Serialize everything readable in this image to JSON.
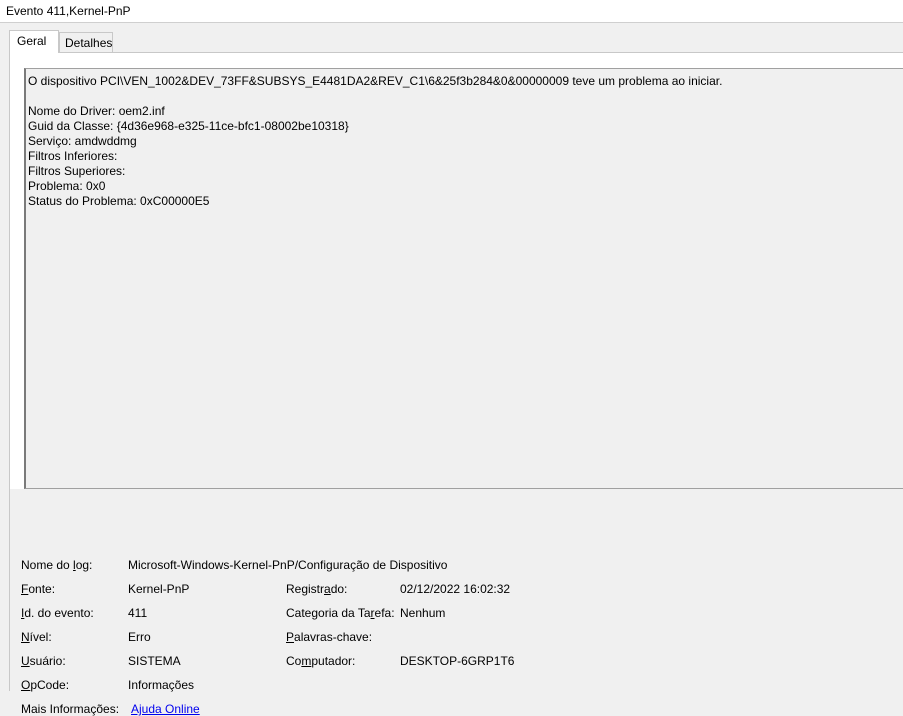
{
  "window": {
    "title": "Evento 411,Kernel-PnP"
  },
  "tabs": [
    {
      "label": "Geral",
      "active": true
    },
    {
      "label": "Detalhes",
      "active": false
    }
  ],
  "description": {
    "lines": [
      "O dispositivo PCI\\VEN_1002&DEV_73FF&SUBSYS_E4481DA2&REV_C1\\6&25f3b284&0&00000009 teve um problema ao iniciar.",
      "",
      "Nome do Driver: oem2.inf",
      "Guid da Classe: {4d36e968-e325-11ce-bfc1-08002be10318}",
      "Serviço: amdwddmg",
      "Filtros Inferiores:",
      "Filtros Superiores:",
      "Problema: 0x0",
      "Status do Problema: 0xC00000E5"
    ]
  },
  "properties": {
    "log_name": {
      "label_pre": "Nome do ",
      "label_u": "l",
      "label_post": "og:",
      "value": "Microsoft-Windows-Kernel-PnP/Configuração de Dispositivo"
    },
    "source": {
      "label_pre": "",
      "label_u": "F",
      "label_post": "onte:",
      "value": "Kernel-PnP"
    },
    "logged": {
      "label_pre": "Registr",
      "label_u": "a",
      "label_post": "do:",
      "value": "02/12/2022 16:02:32"
    },
    "event_id": {
      "label_pre": "",
      "label_u": "I",
      "label_post": "d. do evento:",
      "value": "411"
    },
    "task_category": {
      "label_pre": "Categoria da Ta",
      "label_u": "r",
      "label_post": "efa:",
      "value": "Nenhum"
    },
    "level": {
      "label_pre": "",
      "label_u": "N",
      "label_post": "ível:",
      "value": "Erro"
    },
    "keywords": {
      "label_pre": "",
      "label_u": "P",
      "label_post": "alavras-chave:",
      "value": ""
    },
    "user": {
      "label_pre": "",
      "label_u": "U",
      "label_post": "suário:",
      "value": "SISTEMA"
    },
    "computer": {
      "label_pre": "Co",
      "label_u": "m",
      "label_post": "putador:",
      "value": "DESKTOP-6GRP1T6"
    },
    "opcode": {
      "label_pre": "",
      "label_u": "O",
      "label_post": "pCode:",
      "value": "Informações"
    },
    "more_info": {
      "label_pre": "Mais Informações:",
      "label_u": "",
      "label_post": "",
      "value": "Ajuda Online"
    }
  }
}
